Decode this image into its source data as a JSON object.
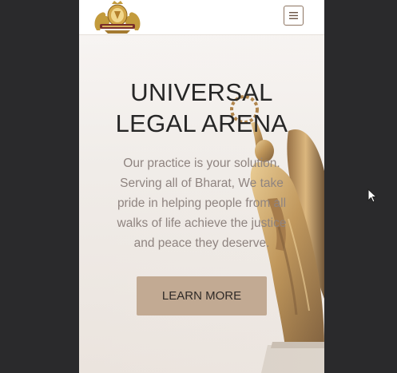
{
  "header": {
    "logo_icon": "lion-crest-logo"
  },
  "menu": {
    "toggle_icon": "hamburger-menu-icon"
  },
  "hero": {
    "title_line1": "UNIVERSAL",
    "title_line2": "LEGAL ARENA",
    "description": "Our practice is your solution. Serving all of Bharat, We take pride in helping people from all walks of life achieve the justice and peace they deserve.",
    "button_label": "LEARN MORE",
    "image": "golden-winged-victory-statue"
  },
  "colors": {
    "background": "#2a2a2c",
    "navbar": "#ffffff",
    "button": "#c2aa93",
    "title_text": "#262626",
    "body_text": "#8f8480",
    "menu_border": "#8d7461"
  }
}
